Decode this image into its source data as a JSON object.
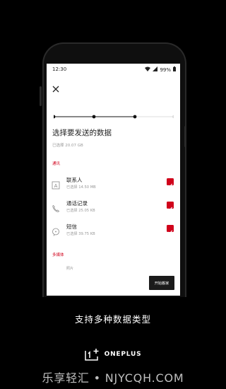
{
  "status_bar": {
    "time": "12:30",
    "battery": "99%"
  },
  "page": {
    "title": "选择要发送的数据",
    "selected_total": "已选择 20.07 GB"
  },
  "sections": {
    "communication": "通讯",
    "media": "多媒体"
  },
  "items": [
    {
      "name": "联系人",
      "meta": "已选择 14.50 MB",
      "checked": true,
      "icon": "contacts-icon"
    },
    {
      "name": "通话记录",
      "meta": "已选择 25.05 KB",
      "checked": true,
      "icon": "phone-icon"
    },
    {
      "name": "短信",
      "meta": "已选择 39.75 KB",
      "checked": true,
      "icon": "message-icon"
    }
  ],
  "truncated_item": "照片",
  "start_button": "开始搬家",
  "caption": "支持多种数据类型",
  "brand": "ONEPLUS",
  "watermark": "乐享轻汇 • NJYCQH.COM",
  "colors": {
    "accent": "#d0021b",
    "button": "#1b1b1b"
  }
}
